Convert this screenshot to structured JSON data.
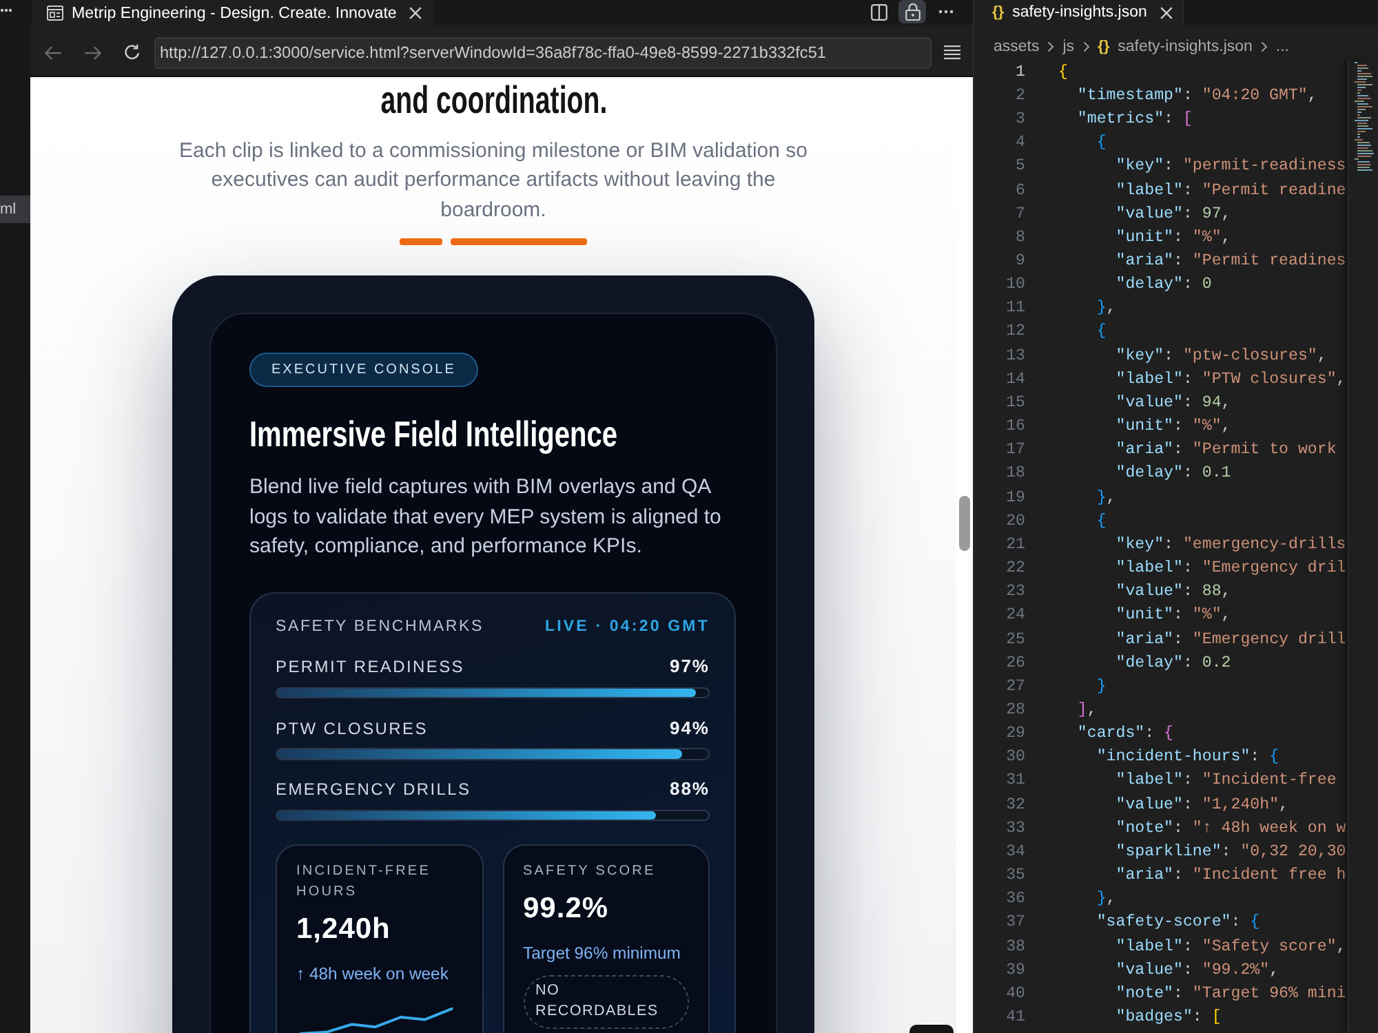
{
  "explorer": {
    "items": [
      {
        "label": "ml",
        "selected": true
      }
    ]
  },
  "browser": {
    "tab": {
      "title": "Metrip Engineering - Design. Create. Innovate"
    },
    "actions": [
      {
        "kind": "split",
        "on": false
      },
      {
        "kind": "lock",
        "on": true
      },
      {
        "kind": "more",
        "on": false
      }
    ],
    "navigation": [
      {
        "kind": "back",
        "disabled": true
      },
      {
        "kind": "forward",
        "disabled": true
      },
      {
        "kind": "reload",
        "disabled": false
      }
    ],
    "address": {
      "value": "http://127.0.0.1:3000/service.html?serverWindowId=36a8f78c-ffa0-49e8-8599-2271b332fc51"
    },
    "page": {
      "heading": "and coordination.",
      "intro": "Each clip is linked to a commissioning milestone or BIM validation so executives can audit performance artifacts without leaving the boardroom.",
      "console": {
        "badge": "EXECUTIVE CONSOLE",
        "title": "Immersive Field Intelligence",
        "description": "Blend live field captures with BIM overlays and QA logs to validate that every MEP system is aligned to safety, compliance, and performance KPIs.",
        "benchmarks": {
          "title": "SAFETY BENCHMARKS",
          "live": "LIVE · 04:20 GMT",
          "metrics": [
            {
              "label": "PERMIT READINESS",
              "value": "97%",
              "level": 0.97
            },
            {
              "label": "PTW CLOSURES",
              "value": "94%",
              "level": 0.94
            },
            {
              "label": "EMERGENCY DRILLS",
              "value": "88%",
              "level": 0.88
            }
          ],
          "cards": [
            {
              "kind": "trend",
              "label": "INCIDENT-FREE HOURS",
              "value": "1,240h",
              "note": "↑ 48h week on week"
            },
            {
              "kind": "score",
              "label": "SAFETY SCORE",
              "value": "99.2%",
              "note": "Target 96% minimum",
              "badges": [
                "NO RECORDABLES"
              ]
            }
          ]
        }
      }
    }
  },
  "editor": {
    "tab": {
      "icon": "{}",
      "title": "safety-insights.json"
    },
    "breadcrumb": [
      {
        "label": "assets"
      },
      {
        "label": "js"
      },
      {
        "icon": "{}",
        "label": "safety-insights.json"
      },
      {
        "label": "..."
      }
    ],
    "lines": [
      {
        "number": "1",
        "active": true,
        "tokens": [
          {
            "kind": "bracket1",
            "text": "{"
          }
        ],
        "children": [
          {
            "number": "2",
            "active": false,
            "tokens": [
              {
                "kind": "key",
                "text": "\"timestamp\""
              },
              {
                "kind": "punct",
                "text": ": "
              },
              {
                "kind": "string",
                "text": "\"04:20 GMT\""
              },
              {
                "kind": "punct",
                "text": ","
              }
            ]
          },
          {
            "number": "3",
            "active": false,
            "tokens": [
              {
                "kind": "key",
                "text": "\"metrics\""
              },
              {
                "kind": "punct",
                "text": ": "
              },
              {
                "kind": "bracket2",
                "text": "["
              }
            ],
            "children": [
              {
                "number": "4",
                "active": false,
                "tokens": [
                  {
                    "kind": "bracket3",
                    "text": "{"
                  }
                ],
                "children": [
                  {
                    "number": "5",
                    "active": false,
                    "tokens": [
                      {
                        "kind": "key",
                        "text": "\"key\""
                      },
                      {
                        "kind": "punct",
                        "text": ": "
                      },
                      {
                        "kind": "string",
                        "text": "\"permit-readiness"
                      }
                    ]
                  },
                  {
                    "number": "6",
                    "active": false,
                    "tokens": [
                      {
                        "kind": "key",
                        "text": "\"label\""
                      },
                      {
                        "kind": "punct",
                        "text": ": "
                      },
                      {
                        "kind": "string",
                        "text": "\"Permit readine"
                      }
                    ]
                  },
                  {
                    "number": "7",
                    "active": false,
                    "tokens": [
                      {
                        "kind": "key",
                        "text": "\"value\""
                      },
                      {
                        "kind": "punct",
                        "text": ": "
                      },
                      {
                        "kind": "number",
                        "text": "97"
                      },
                      {
                        "kind": "punct",
                        "text": ","
                      }
                    ]
                  },
                  {
                    "number": "8",
                    "active": false,
                    "tokens": [
                      {
                        "kind": "key",
                        "text": "\"unit\""
                      },
                      {
                        "kind": "punct",
                        "text": ": "
                      },
                      {
                        "kind": "string",
                        "text": "\"%\""
                      },
                      {
                        "kind": "punct",
                        "text": ","
                      }
                    ]
                  },
                  {
                    "number": "9",
                    "active": false,
                    "tokens": [
                      {
                        "kind": "key",
                        "text": "\"aria\""
                      },
                      {
                        "kind": "punct",
                        "text": ": "
                      },
                      {
                        "kind": "string",
                        "text": "\"Permit readines"
                      }
                    ]
                  },
                  {
                    "number": "10",
                    "active": false,
                    "tokens": [
                      {
                        "kind": "key",
                        "text": "\"delay\""
                      },
                      {
                        "kind": "punct",
                        "text": ": "
                      },
                      {
                        "kind": "number",
                        "text": "0"
                      }
                    ]
                  }
                ]
              },
              {
                "number": "11",
                "active": false,
                "tokens": [
                  {
                    "kind": "bracket3",
                    "text": "}"
                  },
                  {
                    "kind": "punct",
                    "text": ","
                  }
                ]
              },
              {
                "number": "12",
                "active": false,
                "tokens": [
                  {
                    "kind": "bracket3",
                    "text": "{"
                  }
                ],
                "children": [
                  {
                    "number": "13",
                    "active": false,
                    "tokens": [
                      {
                        "kind": "key",
                        "text": "\"key\""
                      },
                      {
                        "kind": "punct",
                        "text": ": "
                      },
                      {
                        "kind": "string",
                        "text": "\"ptw-closures\""
                      },
                      {
                        "kind": "punct",
                        "text": ","
                      }
                    ]
                  },
                  {
                    "number": "14",
                    "active": false,
                    "tokens": [
                      {
                        "kind": "key",
                        "text": "\"label\""
                      },
                      {
                        "kind": "punct",
                        "text": ": "
                      },
                      {
                        "kind": "string",
                        "text": "\"PTW closures\""
                      },
                      {
                        "kind": "punct",
                        "text": ","
                      }
                    ]
                  },
                  {
                    "number": "15",
                    "active": false,
                    "tokens": [
                      {
                        "kind": "key",
                        "text": "\"value\""
                      },
                      {
                        "kind": "punct",
                        "text": ": "
                      },
                      {
                        "kind": "number",
                        "text": "94"
                      },
                      {
                        "kind": "punct",
                        "text": ","
                      }
                    ]
                  },
                  {
                    "number": "16",
                    "active": false,
                    "tokens": [
                      {
                        "kind": "key",
                        "text": "\"unit\""
                      },
                      {
                        "kind": "punct",
                        "text": ": "
                      },
                      {
                        "kind": "string",
                        "text": "\"%\""
                      },
                      {
                        "kind": "punct",
                        "text": ","
                      }
                    ]
                  },
                  {
                    "number": "17",
                    "active": false,
                    "tokens": [
                      {
                        "kind": "key",
                        "text": "\"aria\""
                      },
                      {
                        "kind": "punct",
                        "text": ": "
                      },
                      {
                        "kind": "string",
                        "text": "\"Permit to work"
                      }
                    ]
                  },
                  {
                    "number": "18",
                    "active": false,
                    "tokens": [
                      {
                        "kind": "key",
                        "text": "\"delay\""
                      },
                      {
                        "kind": "punct",
                        "text": ": "
                      },
                      {
                        "kind": "number",
                        "text": "0.1"
                      }
                    ]
                  }
                ]
              },
              {
                "number": "19",
                "active": false,
                "tokens": [
                  {
                    "kind": "bracket3",
                    "text": "}"
                  },
                  {
                    "kind": "punct",
                    "text": ","
                  }
                ]
              },
              {
                "number": "20",
                "active": false,
                "tokens": [
                  {
                    "kind": "bracket3",
                    "text": "{"
                  }
                ],
                "children": [
                  {
                    "number": "21",
                    "active": false,
                    "tokens": [
                      {
                        "kind": "key",
                        "text": "\"key\""
                      },
                      {
                        "kind": "punct",
                        "text": ": "
                      },
                      {
                        "kind": "string",
                        "text": "\"emergency-drills"
                      }
                    ]
                  },
                  {
                    "number": "22",
                    "active": false,
                    "tokens": [
                      {
                        "kind": "key",
                        "text": "\"label\""
                      },
                      {
                        "kind": "punct",
                        "text": ": "
                      },
                      {
                        "kind": "string",
                        "text": "\"Emergency dril"
                      }
                    ]
                  },
                  {
                    "number": "23",
                    "active": false,
                    "tokens": [
                      {
                        "kind": "key",
                        "text": "\"value\""
                      },
                      {
                        "kind": "punct",
                        "text": ": "
                      },
                      {
                        "kind": "number",
                        "text": "88"
                      },
                      {
                        "kind": "punct",
                        "text": ","
                      }
                    ]
                  },
                  {
                    "number": "24",
                    "active": false,
                    "tokens": [
                      {
                        "kind": "key",
                        "text": "\"unit\""
                      },
                      {
                        "kind": "punct",
                        "text": ": "
                      },
                      {
                        "kind": "string",
                        "text": "\"%\""
                      },
                      {
                        "kind": "punct",
                        "text": ","
                      }
                    ]
                  },
                  {
                    "number": "25",
                    "active": false,
                    "tokens": [
                      {
                        "kind": "key",
                        "text": "\"aria\""
                      },
                      {
                        "kind": "punct",
                        "text": ": "
                      },
                      {
                        "kind": "string",
                        "text": "\"Emergency drill"
                      }
                    ]
                  },
                  {
                    "number": "26",
                    "active": false,
                    "tokens": [
                      {
                        "kind": "key",
                        "text": "\"delay\""
                      },
                      {
                        "kind": "punct",
                        "text": ": "
                      },
                      {
                        "kind": "number",
                        "text": "0.2"
                      }
                    ]
                  }
                ]
              },
              {
                "number": "27",
                "active": false,
                "tokens": [
                  {
                    "kind": "bracket3",
                    "text": "}"
                  }
                ]
              }
            ]
          },
          {
            "number": "28",
            "active": false,
            "tokens": [
              {
                "kind": "bracket2",
                "text": "]"
              },
              {
                "kind": "punct",
                "text": ","
              }
            ]
          },
          {
            "number": "29",
            "active": false,
            "tokens": [
              {
                "kind": "key",
                "text": "\"cards\""
              },
              {
                "kind": "punct",
                "text": ": "
              },
              {
                "kind": "bracket2",
                "text": "{"
              }
            ],
            "children": [
              {
                "number": "30",
                "active": false,
                "tokens": [
                  {
                    "kind": "key",
                    "text": "\"incident-hours\""
                  },
                  {
                    "kind": "punct",
                    "text": ": "
                  },
                  {
                    "kind": "bracket3",
                    "text": "{"
                  }
                ],
                "children": [
                  {
                    "number": "31",
                    "active": false,
                    "tokens": [
                      {
                        "kind": "key",
                        "text": "\"label\""
                      },
                      {
                        "kind": "punct",
                        "text": ": "
                      },
                      {
                        "kind": "string",
                        "text": "\"Incident-free"
                      }
                    ]
                  },
                  {
                    "number": "32",
                    "active": false,
                    "tokens": [
                      {
                        "kind": "key",
                        "text": "\"value\""
                      },
                      {
                        "kind": "punct",
                        "text": ": "
                      },
                      {
                        "kind": "string",
                        "text": "\"1,240h\""
                      },
                      {
                        "kind": "punct",
                        "text": ","
                      }
                    ]
                  },
                  {
                    "number": "33",
                    "active": false,
                    "tokens": [
                      {
                        "kind": "key",
                        "text": "\"note\""
                      },
                      {
                        "kind": "punct",
                        "text": ": "
                      },
                      {
                        "kind": "string",
                        "text": "\"↑ 48h week on w"
                      }
                    ]
                  },
                  {
                    "number": "34",
                    "active": false,
                    "tokens": [
                      {
                        "kind": "key",
                        "text": "\"sparkline\""
                      },
                      {
                        "kind": "punct",
                        "text": ": "
                      },
                      {
                        "kind": "string",
                        "text": "\"0,32 20,30"
                      }
                    ]
                  },
                  {
                    "number": "35",
                    "active": false,
                    "tokens": [
                      {
                        "kind": "key",
                        "text": "\"aria\""
                      },
                      {
                        "kind": "punct",
                        "text": ": "
                      },
                      {
                        "kind": "string",
                        "text": "\"Incident free h"
                      }
                    ]
                  }
                ]
              },
              {
                "number": "36",
                "active": false,
                "tokens": [
                  {
                    "kind": "bracket3",
                    "text": "}"
                  },
                  {
                    "kind": "punct",
                    "text": ","
                  }
                ]
              },
              {
                "number": "37",
                "active": false,
                "tokens": [
                  {
                    "kind": "key",
                    "text": "\"safety-score\""
                  },
                  {
                    "kind": "punct",
                    "text": ": "
                  },
                  {
                    "kind": "bracket3",
                    "text": "{"
                  }
                ],
                "children": [
                  {
                    "number": "38",
                    "active": false,
                    "tokens": [
                      {
                        "kind": "key",
                        "text": "\"label\""
                      },
                      {
                        "kind": "punct",
                        "text": ": "
                      },
                      {
                        "kind": "string",
                        "text": "\"Safety score\""
                      },
                      {
                        "kind": "punct",
                        "text": ","
                      }
                    ]
                  },
                  {
                    "number": "39",
                    "active": false,
                    "tokens": [
                      {
                        "kind": "key",
                        "text": "\"value\""
                      },
                      {
                        "kind": "punct",
                        "text": ": "
                      },
                      {
                        "kind": "string",
                        "text": "\"99.2%\""
                      },
                      {
                        "kind": "punct",
                        "text": ","
                      }
                    ]
                  },
                  {
                    "number": "40",
                    "active": false,
                    "tokens": [
                      {
                        "kind": "key",
                        "text": "\"note\""
                      },
                      {
                        "kind": "punct",
                        "text": ": "
                      },
                      {
                        "kind": "string",
                        "text": "\"Target 96% mini"
                      }
                    ]
                  },
                  {
                    "number": "41",
                    "active": false,
                    "tokens": [
                      {
                        "kind": "key",
                        "text": "\"badges\""
                      },
                      {
                        "kind": "punct",
                        "text": ": "
                      },
                      {
                        "kind": "bracket1",
                        "text": "["
                      }
                    ]
                  }
                ]
              }
            ]
          }
        ]
      }
    ]
  }
}
